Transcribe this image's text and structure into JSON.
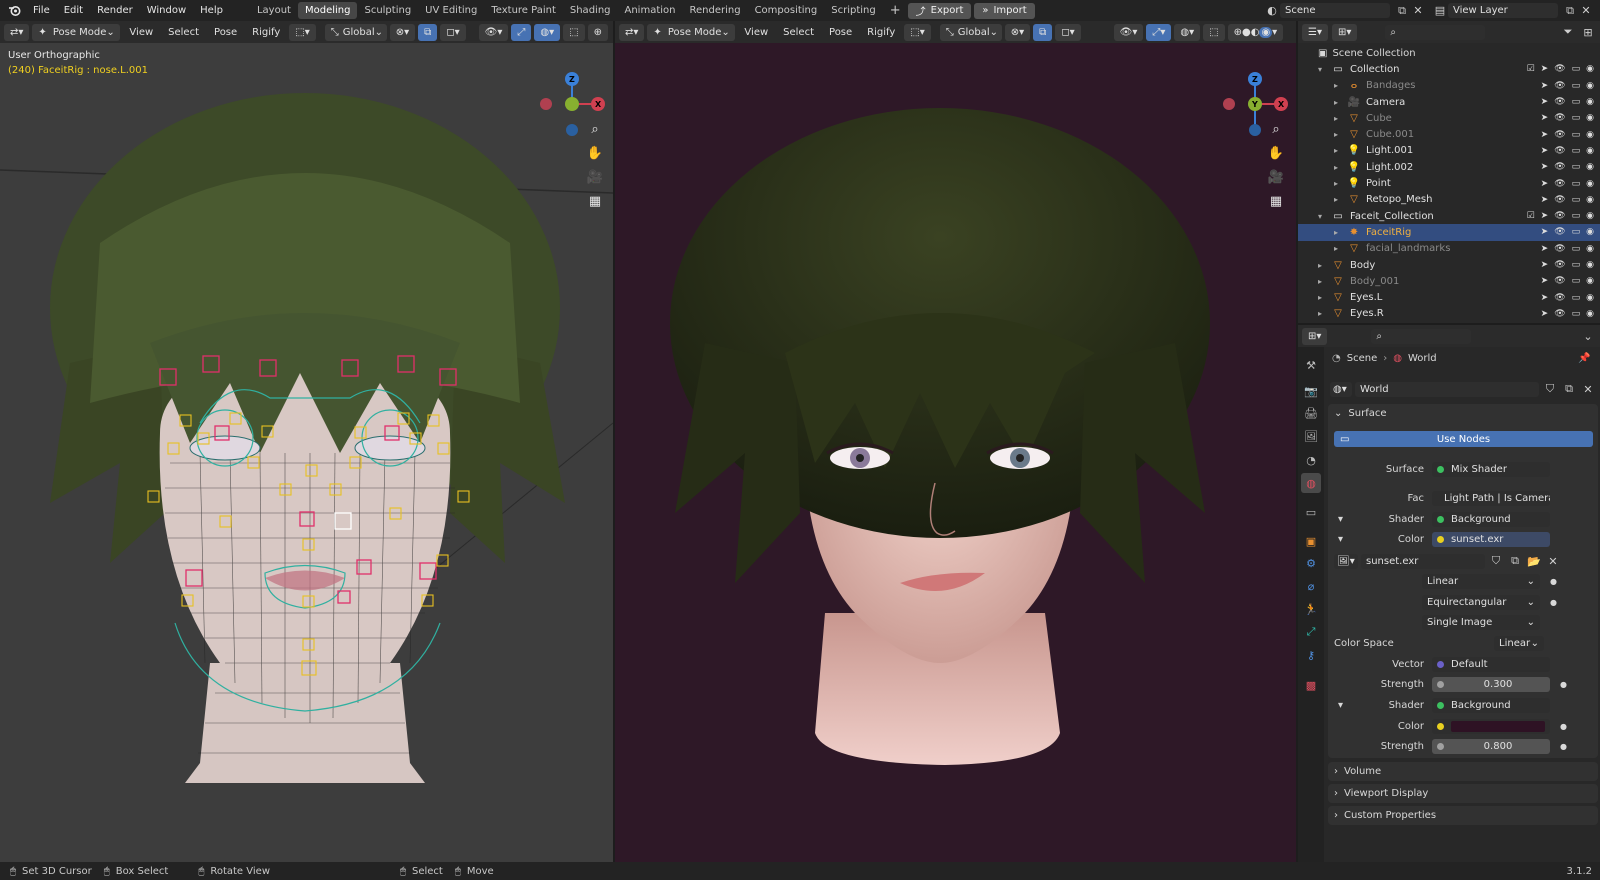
{
  "topbar": {
    "menus": [
      "File",
      "Edit",
      "Render",
      "Window",
      "Help"
    ],
    "workspaces": [
      "Layout",
      "Modeling",
      "Sculpting",
      "UV Editing",
      "Texture Paint",
      "Shading",
      "Animation",
      "Rendering",
      "Compositing",
      "Scripting"
    ],
    "active_workspace": "Modeling",
    "add_tab": "+",
    "export_label": "Export",
    "import_label": "Import",
    "scene_name": "Scene",
    "view_layer": "View Layer"
  },
  "viewport_left": {
    "mode": "Pose Mode",
    "menus": [
      "View",
      "Select",
      "Pose",
      "Rigify"
    ],
    "transform": "Global",
    "view_name": "User Orthographic",
    "active_info": "(240) FaceitRig : nose.L.001"
  },
  "viewport_right": {
    "mode": "Pose Mode",
    "menus": [
      "View",
      "Select",
      "Pose",
      "Rigify"
    ],
    "transform": "Global"
  },
  "gizmo": {
    "x": "X",
    "y": "Y",
    "z": "Z"
  },
  "outliner": {
    "root": "Scene Collection",
    "items": [
      {
        "name": "Collection",
        "level": 1,
        "dim": false,
        "icon": "collection",
        "expanded": true
      },
      {
        "name": "Bandages",
        "level": 2,
        "dim": true,
        "icon": "curve"
      },
      {
        "name": "Camera",
        "level": 2,
        "dim": false,
        "icon": "camera"
      },
      {
        "name": "Cube",
        "level": 2,
        "dim": true,
        "icon": "mesh"
      },
      {
        "name": "Cube.001",
        "level": 2,
        "dim": true,
        "icon": "mesh"
      },
      {
        "name": "Light.001",
        "level": 2,
        "dim": false,
        "icon": "light"
      },
      {
        "name": "Light.002",
        "level": 2,
        "dim": false,
        "icon": "light"
      },
      {
        "name": "Point",
        "level": 2,
        "dim": false,
        "icon": "light"
      },
      {
        "name": "Retopo_Mesh",
        "level": 2,
        "dim": false,
        "icon": "mesh"
      },
      {
        "name": "Faceit_Collection",
        "level": 1,
        "dim": false,
        "icon": "collection",
        "expanded": true
      },
      {
        "name": "FaceitRig",
        "level": 2,
        "dim": false,
        "icon": "armature",
        "selected": true
      },
      {
        "name": "facial_landmarks",
        "level": 2,
        "dim": true,
        "icon": "mesh"
      },
      {
        "name": "Body",
        "level": 1,
        "dim": false,
        "icon": "mesh"
      },
      {
        "name": "Body_001",
        "level": 1,
        "dim": true,
        "icon": "mesh"
      },
      {
        "name": "Eyes.L",
        "level": 1,
        "dim": false,
        "icon": "mesh"
      },
      {
        "name": "Eyes.R",
        "level": 1,
        "dim": false,
        "icon": "mesh"
      }
    ]
  },
  "properties": {
    "breadcrumb": [
      "Scene",
      "World"
    ],
    "world_name": "World",
    "surface_panel": "Surface",
    "use_nodes": "Use Nodes",
    "surface_label": "Surface",
    "surface_value": "Mix Shader",
    "fac_label": "Fac",
    "fac_value": "Light Path | Is Camera ...",
    "shader1_label": "Shader",
    "shader1_value": "Background",
    "color1_label": "Color",
    "color1_value": "sunset.exr",
    "image_name": "sunset.exr",
    "interp": "Linear",
    "projection": "Equirectangular",
    "source": "Single Image",
    "colorspace_label": "Color Space",
    "colorspace_value": "Linear",
    "vector_label": "Vector",
    "vector_value": "Default",
    "strength1_label": "Strength",
    "strength1_value": "0.300",
    "shader2_label": "Shader",
    "shader2_value": "Background",
    "color2_label": "Color",
    "color2_swatch": "#2e1224",
    "strength2_label": "Strength",
    "strength2_value": "0.800",
    "panels": [
      "Volume",
      "Viewport Display",
      "Custom Properties"
    ]
  },
  "statusbar": {
    "items": [
      "Set 3D Cursor",
      "Box Select",
      "Rotate View",
      "Select",
      "Move"
    ],
    "version": "3.1.2"
  },
  "colors": {
    "accent": "#4772b3",
    "selected_row": "#334d80",
    "viewport_right_bg": "#2e1827",
    "viewport_left_bg": "#3d3d3d"
  }
}
